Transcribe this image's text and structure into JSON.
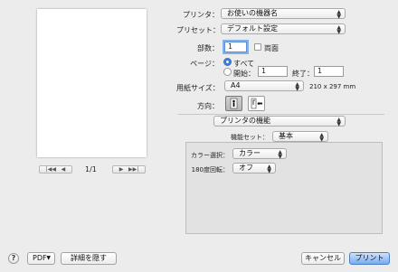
{
  "preview": {
    "page_indicator": "1/1"
  },
  "printer": {
    "label": "プリンタ：",
    "value": "お使いの機器名"
  },
  "preset": {
    "label": "プリセット：",
    "value": "デフォルト設定"
  },
  "copies": {
    "label": "部数：",
    "value": "1",
    "duplex_label": "両面"
  },
  "pages": {
    "label": "ページ：",
    "all_label": "すべて",
    "range_label": "開始：",
    "from_value": "1",
    "to_label": "終了：",
    "to_value": "1"
  },
  "paper": {
    "label": "用紙サイズ：",
    "value": "A4",
    "dims": "210 x 297 mm"
  },
  "orientation": {
    "label": "方向："
  },
  "section": {
    "value": "プリンタの機能"
  },
  "feature_set": {
    "label": "機能セット：",
    "value": "基本"
  },
  "color": {
    "label": "カラー選択：",
    "value": "カラー"
  },
  "rotate": {
    "label": "180度回転：",
    "value": "オフ"
  },
  "footer": {
    "help": "?",
    "pdf": "PDF",
    "hide_details": "詳細を隠す",
    "cancel": "キャンセル",
    "print": "プリント"
  },
  "colors": {
    "accent": "#3a7de0",
    "primary_button": "#77abef"
  }
}
